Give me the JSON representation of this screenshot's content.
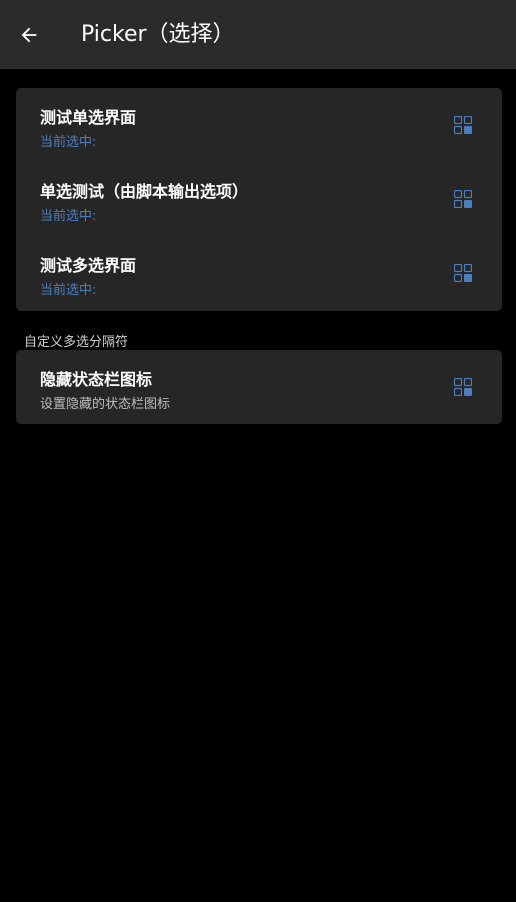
{
  "app_bar": {
    "back_icon": "arrow-left-icon",
    "title": "Picker（选择）"
  },
  "group1": {
    "items": [
      {
        "title": "测试单选界面",
        "subtitle": "当前选中:",
        "icon": "grid-icon"
      },
      {
        "title": "单选测试（由脚本输出选项）",
        "subtitle": "当前选中:",
        "icon": "grid-icon"
      },
      {
        "title": "测试多选界面",
        "subtitle": "当前选中:",
        "icon": "grid-icon"
      }
    ]
  },
  "section2": {
    "label": "自定义多选分隔符",
    "items": [
      {
        "title": "隐藏状态栏图标",
        "subtitle": "设置隐藏的状态栏图标",
        "icon": "grid-icon"
      }
    ]
  },
  "colors": {
    "app_bar_bg": "#2b2b2b",
    "card_bg": "#262626",
    "accent_blue": "#4a7fbf",
    "background": "#000000"
  }
}
